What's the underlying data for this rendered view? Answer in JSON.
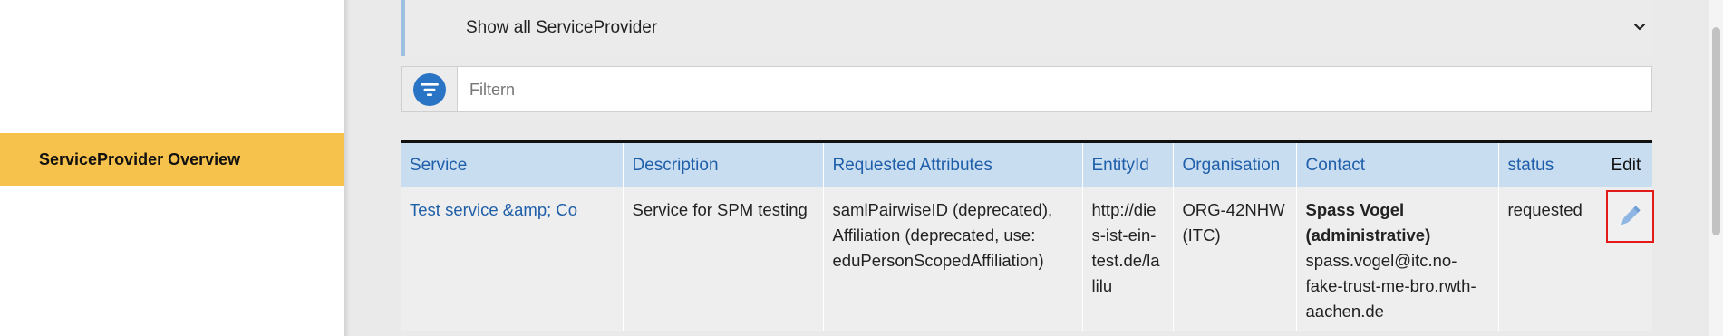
{
  "sidebar": {
    "active_item": "ServiceProvider Overview"
  },
  "filter_select": {
    "selected": "Show all ServiceProvider"
  },
  "filter": {
    "placeholder": "Filtern",
    "value": ""
  },
  "table": {
    "columns": [
      "Service",
      "Description",
      "Requested Attributes",
      "EntityId",
      "Organisation",
      "Contact",
      "status",
      "Edit"
    ],
    "rows": [
      {
        "service": "Test service &amp; Co",
        "description": "Service for SPM testing",
        "requested_attributes": "samlPairwiseID (deprecated), Affiliation (deprecated, use: eduPersonScopedAffiliation)",
        "entity_id": "http://dies-ist-ein-test.de/lalilu",
        "organisation": "ORG-42NHW (ITC)",
        "contact_name": "Spass Vogel (administrative)",
        "contact_email": "spass.vogel@itc.no-fake-trust-me-bro.rwth-aachen.de",
        "status": "requested"
      }
    ]
  },
  "icons": {
    "filter": "filter-icon",
    "chevron": "chevron-down-icon",
    "edit": "pencil-icon"
  },
  "colors": {
    "accent": "#f7c24b",
    "header_bg": "#c9ddf1",
    "link": "#1f5fa9",
    "filter_button": "#2a74c6",
    "highlight_border": "#e21a1a"
  }
}
